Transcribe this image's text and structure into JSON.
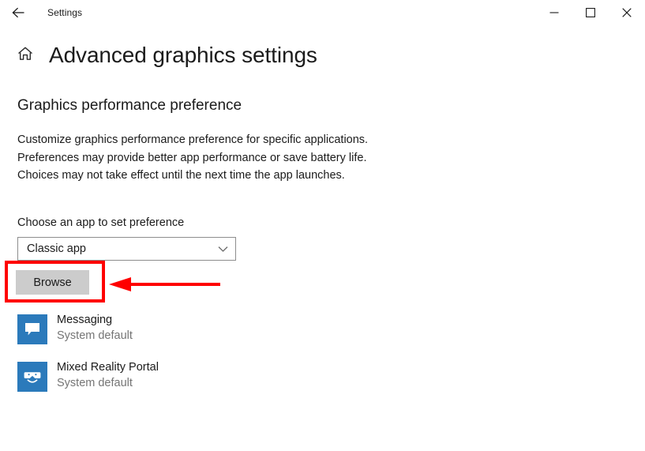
{
  "window": {
    "app_title": "Settings",
    "back_icon": "back-arrow-icon",
    "controls": {
      "minimize": "minimize-icon",
      "maximize": "maximize-icon",
      "close": "close-icon"
    }
  },
  "header": {
    "home_icon": "home-icon",
    "title": "Advanced graphics settings"
  },
  "main": {
    "section_title": "Graphics performance preference",
    "description": "Customize graphics performance preference for specific applications. Preferences may provide better app performance or save battery life. Choices may not take effect until the next time the app launches.",
    "choose_label": "Choose an app to set preference",
    "dropdown": {
      "value": "Classic app",
      "chevron_icon": "chevron-down-icon"
    },
    "browse_label": "Browse"
  },
  "annotations": {
    "highlight_color": "#ff0000",
    "rect_target": "browse-button",
    "arrow_direction": "left"
  },
  "app_list": [
    {
      "name": "Messaging",
      "preference": "System default",
      "icon": "messaging-icon",
      "icon_color": "#2b7abb"
    },
    {
      "name": "Mixed Reality Portal",
      "preference": "System default",
      "icon": "mixed-reality-portal-icon",
      "icon_color": "#2b7abb"
    }
  ]
}
